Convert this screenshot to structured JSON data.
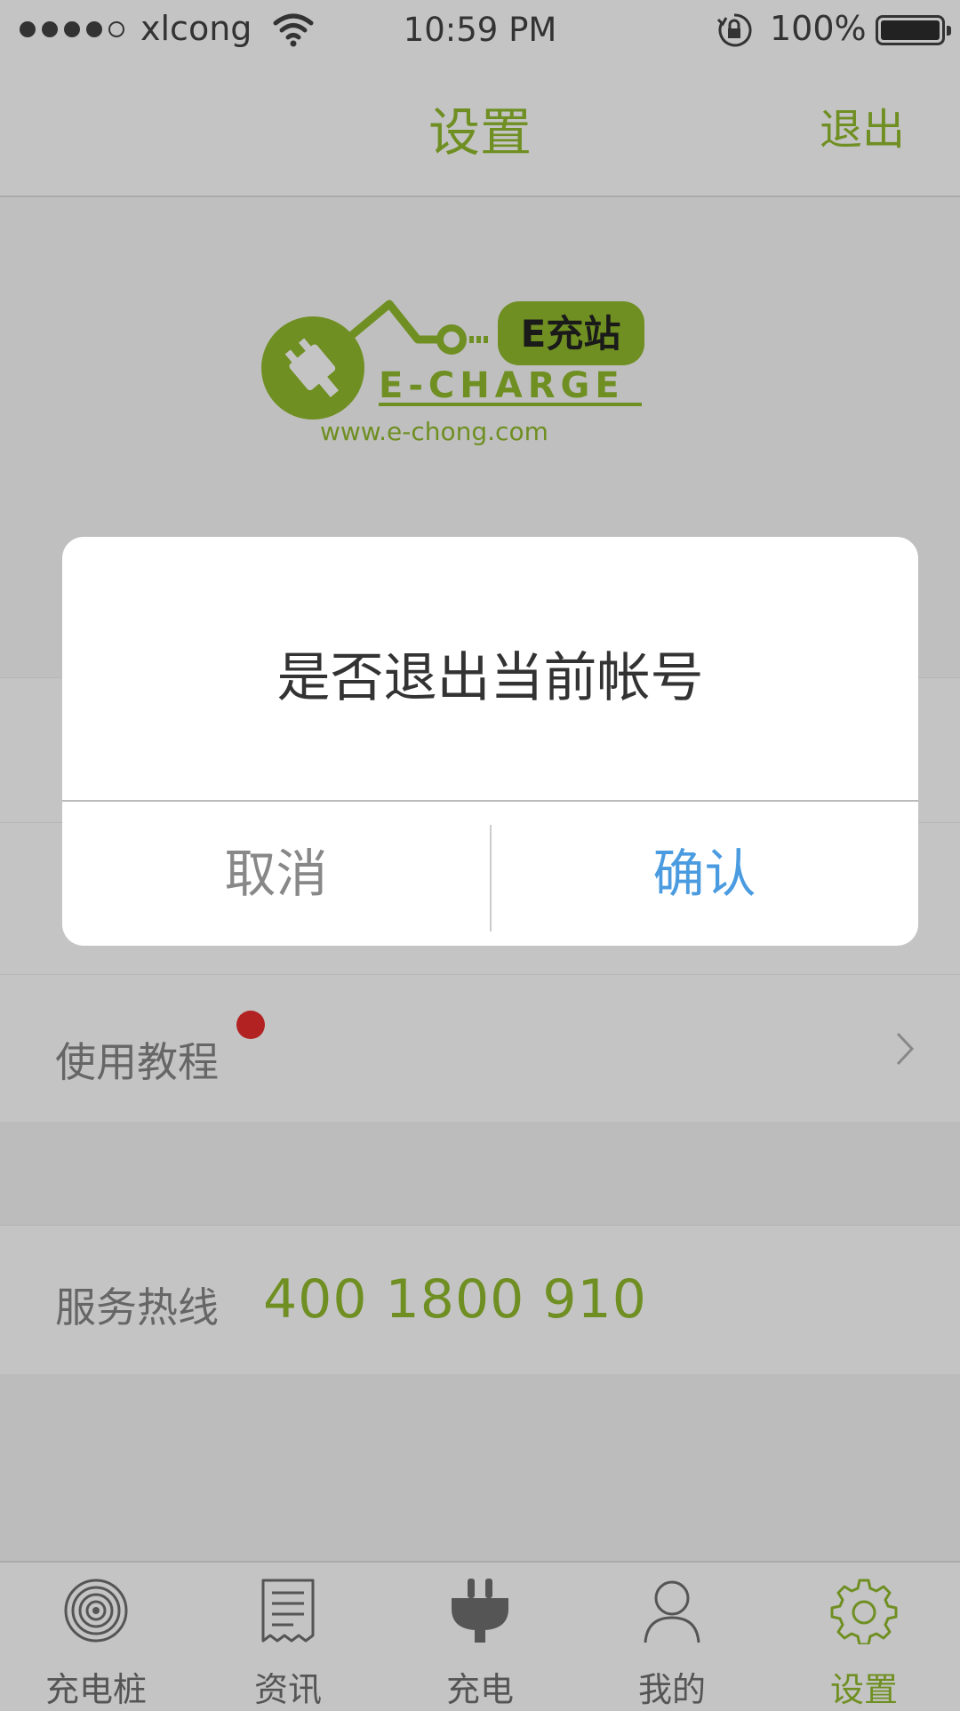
{
  "status_bar": {
    "carrier": "xlcong",
    "time": "10:59 PM",
    "battery": "100%"
  },
  "nav": {
    "title": "设置",
    "exit_label": "退出"
  },
  "logo": {
    "badge": "E充站",
    "wordmark": "E-CHARGE",
    "url": "www.e-chong.com"
  },
  "settings": {
    "tutorial_label": "使用教程",
    "hotline_label": "服务热线",
    "hotline_number": "400 1800 910"
  },
  "dialog": {
    "message": "是否退出当前帐号",
    "cancel_label": "取消",
    "confirm_label": "确认"
  },
  "tabs": [
    {
      "label": "充电桩",
      "icon": "charging-pile-icon"
    },
    {
      "label": "资讯",
      "icon": "news-icon"
    },
    {
      "label": "充电",
      "icon": "plug-icon"
    },
    {
      "label": "我的",
      "icon": "user-icon"
    },
    {
      "label": "设置",
      "icon": "gear-icon",
      "active": true
    }
  ],
  "colors": {
    "brand_green": "#6f8f22",
    "confirm_blue": "#4a9be0",
    "badge_red": "#b22222"
  }
}
